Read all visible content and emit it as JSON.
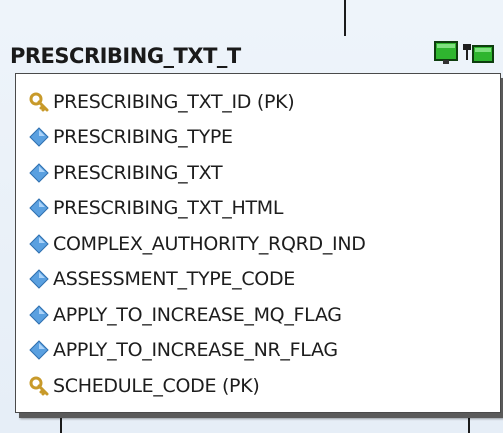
{
  "entity": {
    "title": "PRESCRIBING_TXT_T",
    "fields": [
      {
        "name": "PRESCRIBING_TXT_ID (PK)",
        "icon": "key-icon"
      },
      {
        "name": "PRESCRIBING_TYPE",
        "icon": "diamond-icon"
      },
      {
        "name": "PRESCRIBING_TXT",
        "icon": "diamond-icon"
      },
      {
        "name": "PRESCRIBING_TXT_HTML",
        "icon": "diamond-icon"
      },
      {
        "name": "COMPLEX_AUTHORITY_RQRD_IND",
        "icon": "diamond-icon"
      },
      {
        "name": "ASSESSMENT_TYPE_CODE",
        "icon": "diamond-icon"
      },
      {
        "name": "APPLY_TO_INCREASE_MQ_FLAG",
        "icon": "diamond-icon"
      },
      {
        "name": "APPLY_TO_INCREASE_NR_FLAG",
        "icon": "diamond-icon"
      },
      {
        "name": "SCHEDULE_CODE (PK)",
        "icon": "key-icon"
      }
    ],
    "table_icon": "database-table-icon"
  },
  "colors": {
    "background": "#e9f1f9",
    "key": "#c89a2a",
    "diamond": "#5aa0e0",
    "icon_green": "#2fb52f"
  }
}
